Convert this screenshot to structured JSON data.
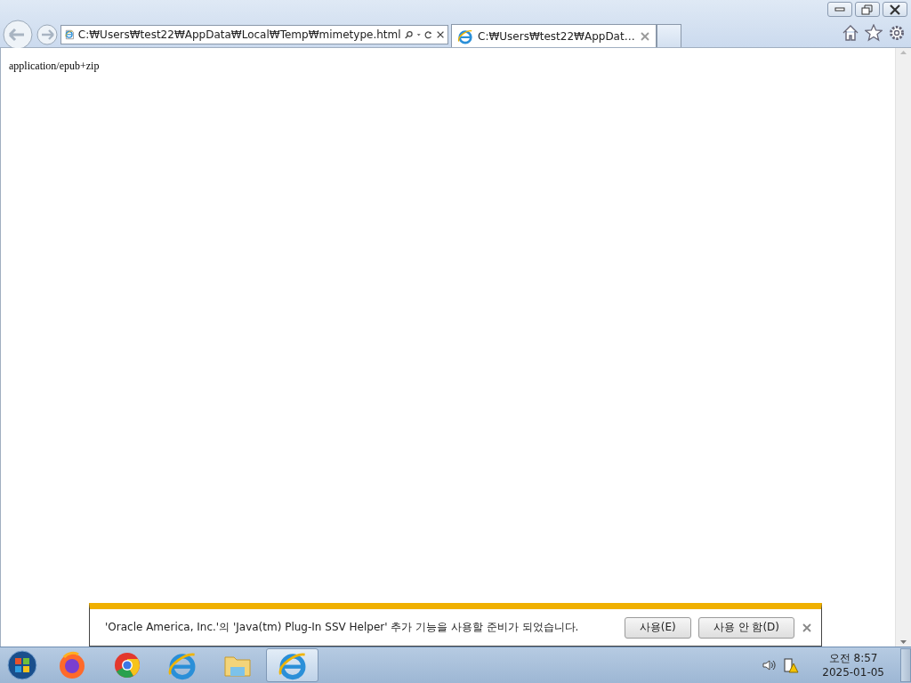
{
  "address_bar": {
    "value": "C:₩Users₩test22₩AppData₩Local₩Temp₩mimetype.html"
  },
  "tabs": [
    {
      "label": "C:₩Users₩test22₩AppDat…",
      "selected": true
    }
  ],
  "page": {
    "text": "application/epub+zip"
  },
  "notification": {
    "message": "'Oracle America, Inc.'의 'Java(tm) Plug-In SSV Helper' 추가 기능을 사용할 준비가 되었습니다.",
    "buttons": [
      "사용(E)",
      "사용 안 함(D)"
    ]
  },
  "taskbar": {
    "apps": [
      {
        "kind": "start",
        "selected": false
      },
      {
        "kind": "firefox",
        "selected": false
      },
      {
        "kind": "chrome",
        "selected": false
      },
      {
        "kind": "ie",
        "selected": false
      },
      {
        "kind": "explorer",
        "selected": false
      },
      {
        "kind": "ie",
        "selected": true
      }
    ],
    "clock": {
      "time": "오전 8:57",
      "date": "2025-01-05"
    }
  }
}
